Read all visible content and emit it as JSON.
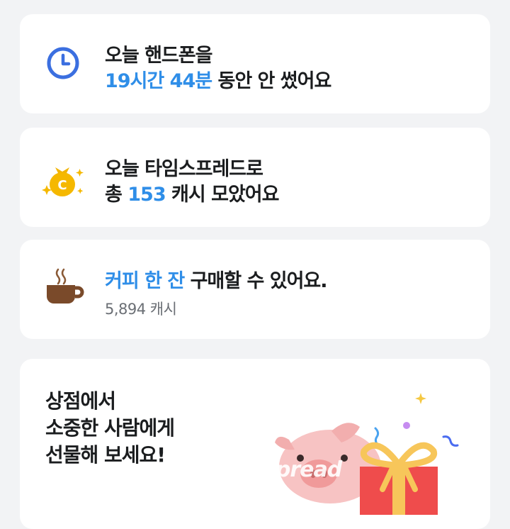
{
  "cards": [
    {
      "icon": "clock-icon",
      "line1": "오늘 핸드폰을",
      "line2_accent": "19시간 44분",
      "line2_rest": " 동안 안 썼어요"
    },
    {
      "icon": "coin-bag-icon",
      "line1": "오늘 타임스프레드로",
      "line2_prefix": "총 ",
      "line2_accent": "153",
      "line2_rest": " 캐시 모았어요"
    },
    {
      "icon": "coffee-cup-icon",
      "line1_accent": "커피 한 잔",
      "line1_rest": " 구매할 수 있어요.",
      "sub": "5,894 캐시"
    }
  ],
  "promo": {
    "lines": [
      "상점에서",
      "소중한 사람에게",
      "선물해 보세요!"
    ],
    "illustration": "pig-with-gift-illustration",
    "watermark": "spread"
  },
  "colors": {
    "accent": "#2f8ee8",
    "background": "#f2f3f5",
    "card": "#ffffff"
  }
}
